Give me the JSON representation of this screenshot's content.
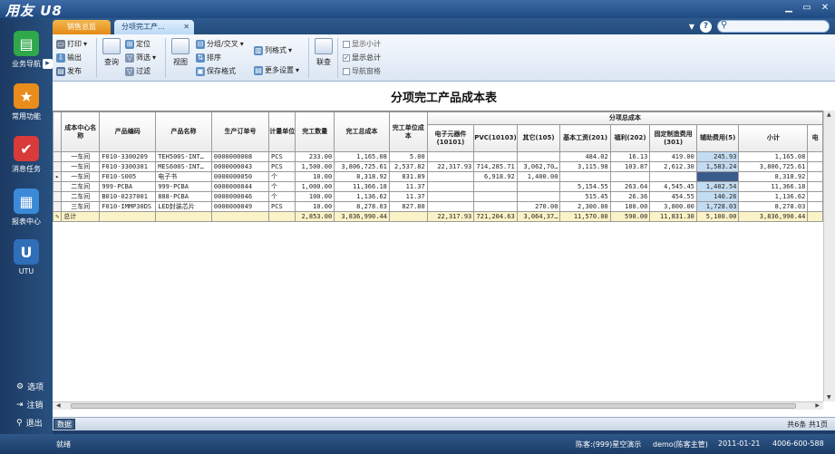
{
  "app": {
    "logo": "用友 U8"
  },
  "window_controls": [
    "▁",
    "▭",
    "✕"
  ],
  "sidebar": {
    "items": [
      {
        "label": "业务导航",
        "icon": "book-icon",
        "color": "#2ea84a"
      },
      {
        "label": "常用功能",
        "icon": "star-icon",
        "color": "#e98c1b"
      },
      {
        "label": "消息任务",
        "icon": "task-icon",
        "color": "#d93a3a"
      },
      {
        "label": "报表中心",
        "icon": "report-icon",
        "color": "#3a8ad8"
      },
      {
        "label": "UTU",
        "icon": "utu-icon",
        "color": "#2f6fb8"
      }
    ],
    "bottom": [
      {
        "label": "选项",
        "icon": "gear-icon"
      },
      {
        "label": "注销",
        "icon": "logout-icon"
      },
      {
        "label": "退出",
        "icon": "exit-icon"
      }
    ]
  },
  "tabs": [
    {
      "label": "销售总监",
      "active": false
    },
    {
      "label": "分项完工产…",
      "active": true
    }
  ],
  "toolbar": {
    "print": "打印",
    "output": "输出",
    "publish": "发布",
    "query": "查询",
    "locate": "定位",
    "filter": "筛选",
    "filter2": "过滤",
    "view": "视图",
    "group": "分组/交叉",
    "sort": "排序",
    "save_format": "保存格式",
    "column_format": "列格式",
    "more_settings": "更多设置",
    "link_query": "联查",
    "show_subtotal": "显示小计",
    "show_total": "显示总计",
    "nav_window": "导航窗格"
  },
  "report": {
    "title": "分项完工产品成本表",
    "group_header": "分项总成本",
    "columns": {
      "center": "成本中心名称",
      "code": "产品编码",
      "name": "产品名称",
      "order": "生产订单号",
      "unit": "计量单位",
      "qty": "完工数量",
      "total_cost": "完工总成本",
      "unit_cost": "完工单位成本",
      "elec": "电子元器件(10101)",
      "pvc": "PVC(10103)",
      "other": "其它(105)",
      "wage": "基本工资(201)",
      "welfare": "福利(202)",
      "fixed": "固定制造费用(301)",
      "aux": "辅助费用(5)",
      "subtotal": "小计",
      "extra": "电"
    },
    "rows": [
      {
        "center": "一车间",
        "code": "F010-3300209",
        "name": "TEH500S-INT…",
        "order": "0000000008",
        "unit": "PCS",
        "qty": "233.00",
        "total_cost": "1,165.08",
        "unit_cost": "5.00",
        "elec": "",
        "pvc": "",
        "other": "",
        "wage": "484.02",
        "welfare": "16.13",
        "fixed": "419.00",
        "aux": "245.93",
        "subtotal": "1,165.08"
      },
      {
        "center": "一车间",
        "code": "F010-3300301",
        "name": "MES600S-INT…",
        "order": "0000000043",
        "unit": "PCS",
        "qty": "1,500.00",
        "total_cost": "3,806,725.61",
        "unit_cost": "2,537.82",
        "elec": "22,317.93",
        "pvc": "714,285.71",
        "other": "3,062,70…",
        "wage": "3,115.98",
        "welfare": "103.87",
        "fixed": "2,612.30",
        "aux": "1,583.24",
        "subtotal": "3,806,725.61"
      },
      {
        "center": "一车间",
        "code": "F010-S005",
        "name": "电子书",
        "order": "0000000050",
        "unit": "个",
        "qty": "10.00",
        "total_cost": "8,318.92",
        "unit_cost": "831.89",
        "elec": "",
        "pvc": "6,918.92",
        "other": "1,400.00",
        "wage": "",
        "welfare": "",
        "fixed": "",
        "aux": "",
        "subtotal": "8,318.92"
      },
      {
        "center": "二车间",
        "code": "999-PCBA",
        "name": "999-PCBA",
        "order": "0000000044",
        "unit": "个",
        "qty": "1,000.00",
        "total_cost": "11,366.18",
        "unit_cost": "11.37",
        "elec": "",
        "pvc": "",
        "other": "",
        "wage": "5,154.55",
        "welfare": "263.64",
        "fixed": "4,545.45",
        "aux": "1,402.54",
        "subtotal": "11,366.18"
      },
      {
        "center": "二车间",
        "code": "B010-0237001",
        "name": "888-PCBA",
        "order": "0000000046",
        "unit": "个",
        "qty": "100.00",
        "total_cost": "1,136.62",
        "unit_cost": "11.37",
        "elec": "",
        "pvc": "",
        "other": "",
        "wage": "515.45",
        "welfare": "26.36",
        "fixed": "454.55",
        "aux": "140.26",
        "subtotal": "1,136.62"
      },
      {
        "center": "三车间",
        "code": "F010-IMMP30DS",
        "name": "LED封装芯片",
        "order": "0000000049",
        "unit": "PCS",
        "qty": "10.00",
        "total_cost": "8,278.03",
        "unit_cost": "827.80",
        "elec": "",
        "pvc": "",
        "other": "270.00",
        "wage": "2,300.00",
        "welfare": "180.00",
        "fixed": "3,800.00",
        "aux": "1,728.03",
        "subtotal": "8,278.03"
      }
    ],
    "total": {
      "center": "总计",
      "qty": "2,853.00",
      "total_cost": "3,836,990.44",
      "elec": "22,317.93",
      "pvc": "721,204.63",
      "other": "3,064,37…",
      "wage": "11,570.00",
      "welfare": "590.00",
      "fixed": "11,831.30",
      "aux": "5,100.00",
      "subtotal": "3,836,990.44"
    }
  },
  "databar": {
    "tab": "数据",
    "page_info": "共6条 共1页"
  },
  "status": {
    "ready": "就绪",
    "account": "陈客:(999)星空演示",
    "user": "demo(陈客主管)",
    "date": "2011-01-21",
    "phone": "4006-600-588"
  }
}
